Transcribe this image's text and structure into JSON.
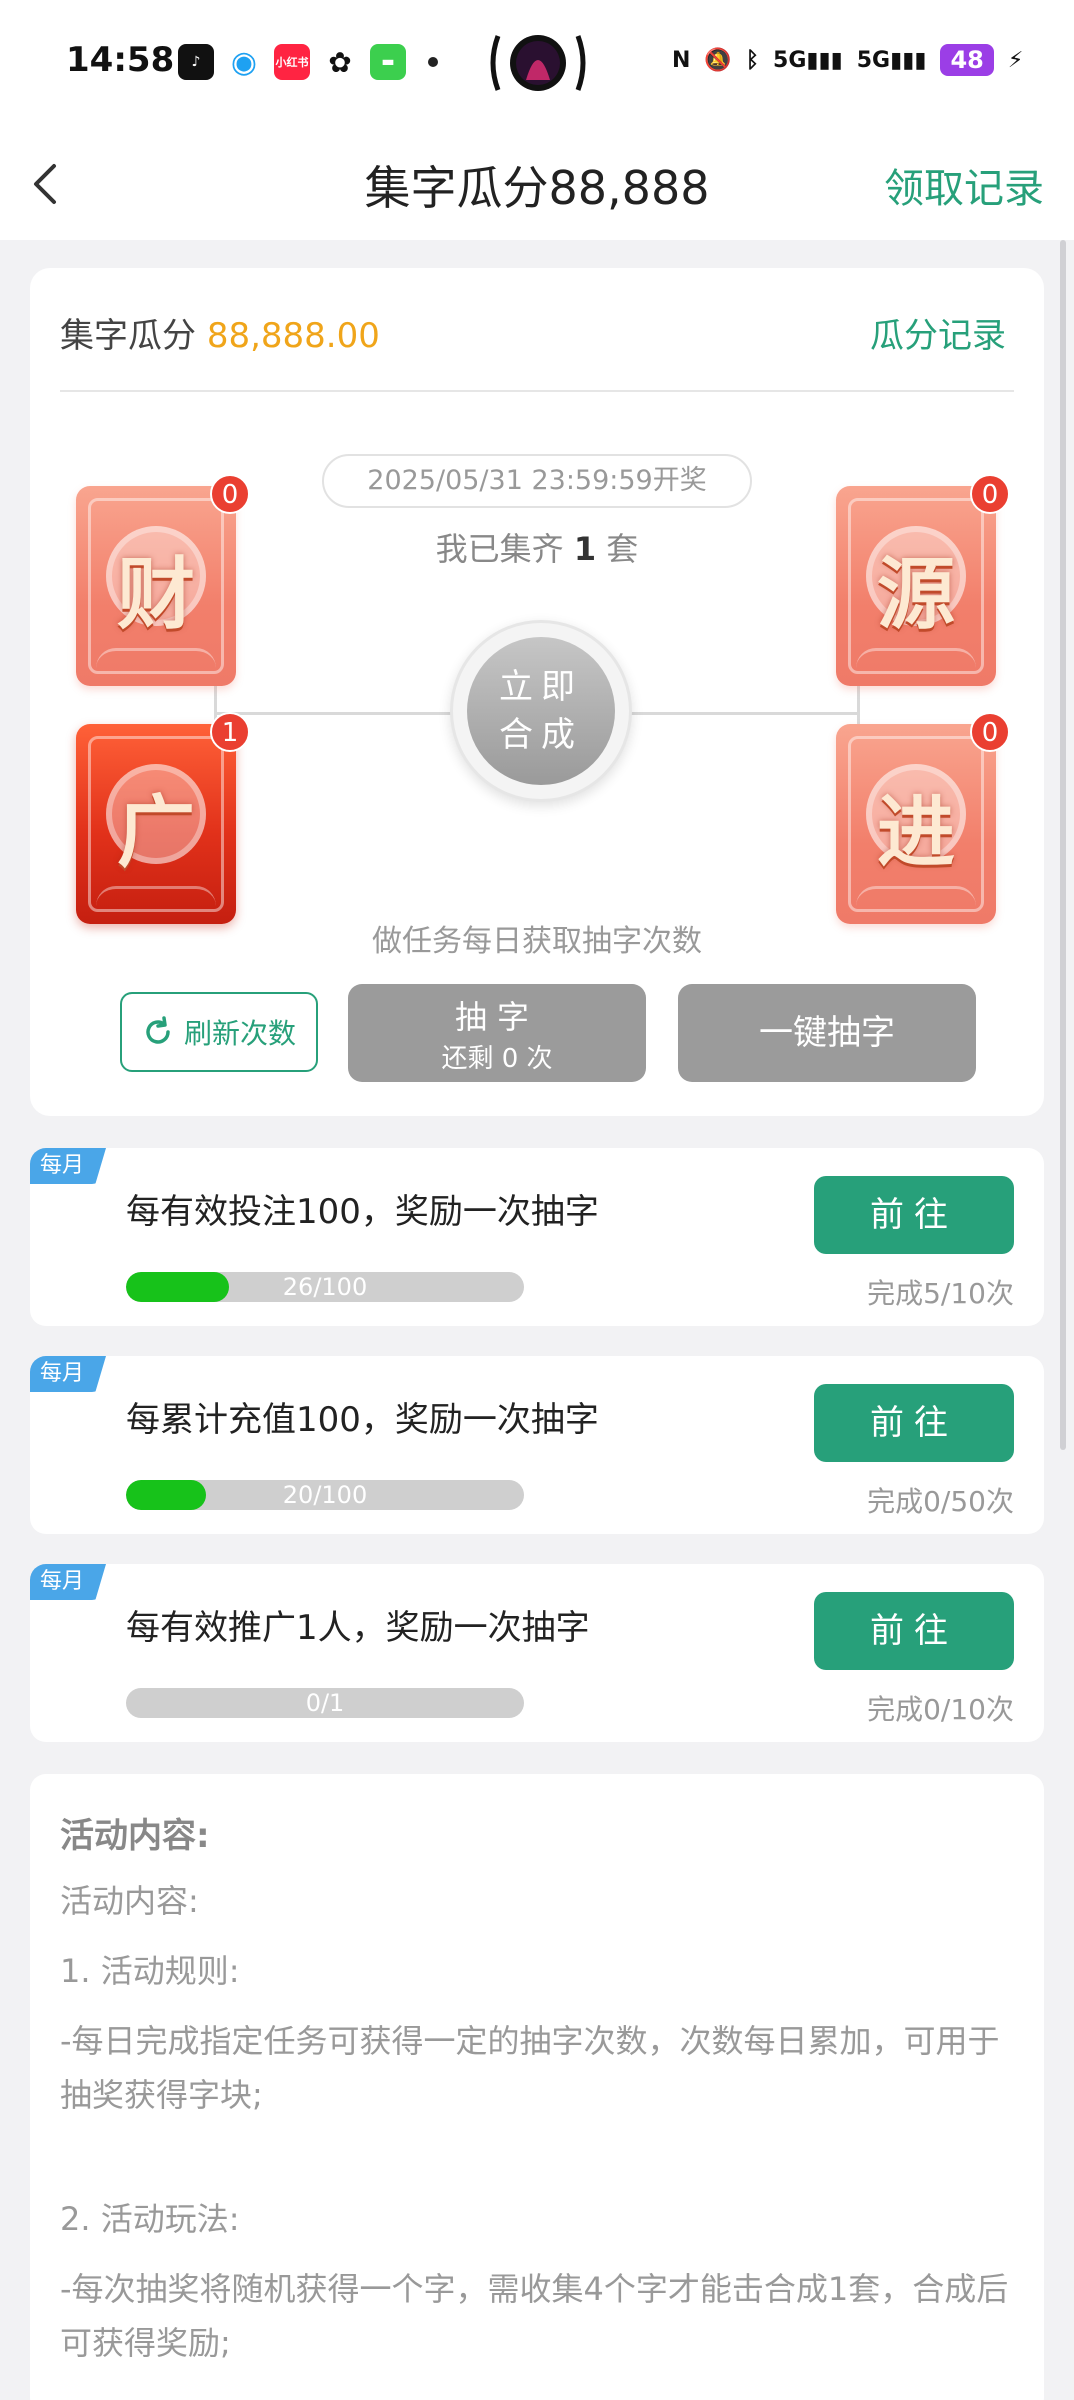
{
  "status_bar": {
    "time": "14:58",
    "network_1": "5G",
    "network_2": "5G",
    "battery": "48"
  },
  "nav": {
    "title": "集字瓜分88,888",
    "right_link": "领取记录"
  },
  "pool": {
    "label": "集字瓜分",
    "amount": "88,888.00",
    "record_link": "瓜分记录"
  },
  "draw": {
    "date": "2025/05/31 23:59:59开奖",
    "collected_prefix": "我已集齐",
    "collected_count": "1",
    "collected_suffix": "套",
    "merge_line1": "立即",
    "merge_line2": "合成",
    "task_hint": "做任务每日获取抽字次数"
  },
  "characters": [
    {
      "char": "财",
      "count": "0",
      "state": "pale"
    },
    {
      "char": "广",
      "count": "1",
      "state": "bright"
    },
    {
      "char": "源",
      "count": "0",
      "state": "pale"
    },
    {
      "char": "进",
      "count": "0",
      "state": "pale"
    }
  ],
  "buttons": {
    "refresh": "刷新次数",
    "draw_label": "抽字",
    "draw_remaining": "还剩 0 次",
    "one_key": "一键抽字"
  },
  "tasks": [
    {
      "tag": "每月",
      "title": "每有效投注100，奖励一次抽字",
      "progress_text": "26/100",
      "progress": 0.26,
      "go": "前往",
      "count": "完成5/10次"
    },
    {
      "tag": "每月",
      "title": "每累计充值100，奖励一次抽字",
      "progress_text": "20/100",
      "progress": 0.2,
      "go": "前往",
      "count": "完成0/50次"
    },
    {
      "tag": "每月",
      "title": "每有效推广1人，奖励一次抽字",
      "progress_text": "0/1",
      "progress": 0,
      "go": "前往",
      "count": "完成0/10次"
    }
  ],
  "rules": {
    "heading": "活动内容:",
    "p1": "活动内容:",
    "p2": "1. 活动规则:",
    "p3": "-每日完成指定任务可获得一定的抽字次数，次数每日累加，可用于抽奖获得字块;",
    "p4": "2. 活动玩法:",
    "p5": "-每次抽奖将随机获得一个字，需收集4个字才能击合成1套，合成后可获得奖励;"
  },
  "colors": {
    "accent": "#27a07a",
    "amount": "#f0a51a",
    "progress_fill": "#17c21a",
    "badge": "#ea3f31",
    "disabled_button": "#9b9b9b",
    "tag": "#4aa6e8"
  }
}
